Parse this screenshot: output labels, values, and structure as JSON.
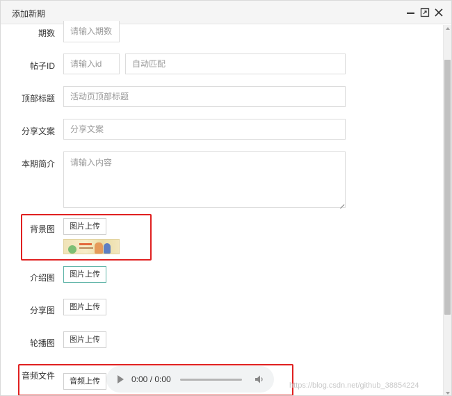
{
  "dialog": {
    "title": "添加新期"
  },
  "form": {
    "period": {
      "label": "期数",
      "placeholder": "请输入期数"
    },
    "post_id": {
      "label": "帖子ID",
      "placeholder": "请输入id",
      "auto_placeholder": "自动匹配"
    },
    "top_title": {
      "label": "顶部标题",
      "placeholder": "活动页顶部标题"
    },
    "share_text": {
      "label": "分享文案",
      "placeholder": "分享文案"
    },
    "intro": {
      "label": "本期简介",
      "placeholder": "请输入内容"
    },
    "background_image": {
      "label": "背景图",
      "button": "图片上传"
    },
    "intro_image": {
      "label": "介绍图",
      "button": "图片上传"
    },
    "share_image": {
      "label": "分享图",
      "button": "图片上传"
    },
    "carousel_image": {
      "label": "轮播图",
      "button": "图片上传"
    },
    "audio_file": {
      "label": "音频文件",
      "button": "音频上传"
    }
  },
  "audio_player": {
    "time": "0:00 / 0:00"
  },
  "watermark": "https://blog.csdn.net/github_38854224",
  "colors": {
    "highlight": "#e02020",
    "focus_border": "#5fb4a8",
    "titlebar_bg": "#f5f5f5"
  }
}
